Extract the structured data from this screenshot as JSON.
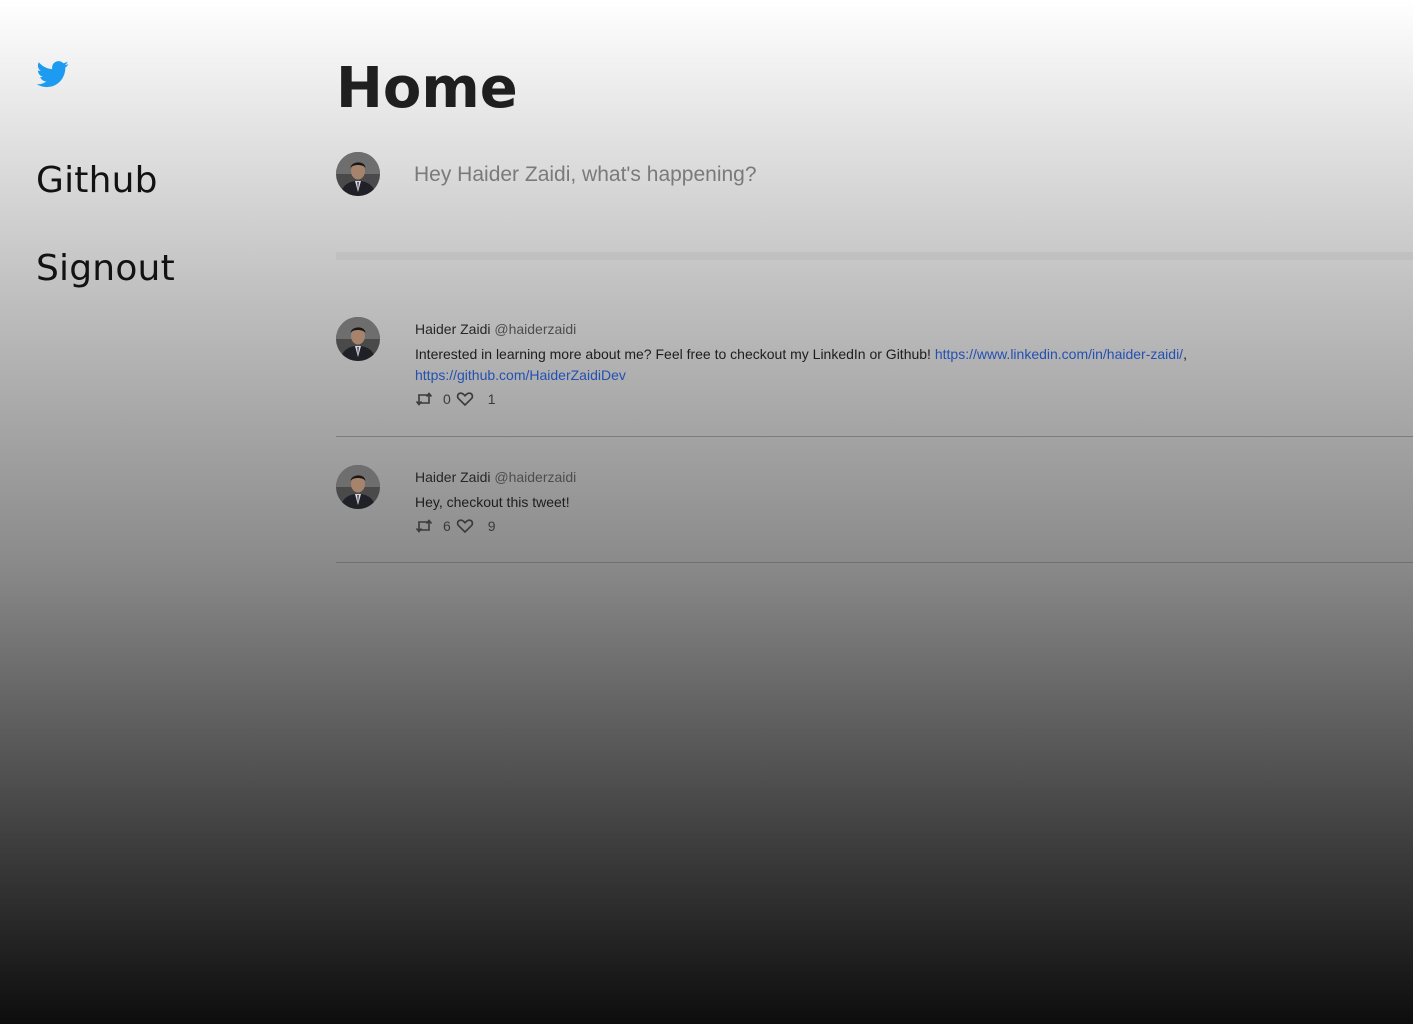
{
  "sidebar": {
    "logo_icon": "twitter-bird-icon",
    "nav_items": [
      {
        "label": "Github"
      },
      {
        "label": "Signout"
      }
    ]
  },
  "main": {
    "title": "Home",
    "compose": {
      "placeholder": "Hey Haider Zaidi, what's happening?",
      "value": ""
    },
    "tweets": [
      {
        "author_name": "Haider Zaidi",
        "author_handle": "@haiderzaidi",
        "text": "Interested in learning more about me? Feel free to checkout my LinkedIn or Github! ",
        "links": [
          "https://www.linkedin.com/in/haider-zaidi/",
          "https://github.com/HaiderZaidiDev"
        ],
        "link_separator": ",",
        "retweet_count": "0",
        "like_count": "1"
      },
      {
        "author_name": "Haider Zaidi",
        "author_handle": "@haiderzaidi",
        "text": "Hey, checkout this tweet!",
        "retweet_count": "6",
        "like_count": "9"
      }
    ]
  },
  "colors": {
    "brand": "#1d9bf0",
    "link": "#2450b3"
  }
}
